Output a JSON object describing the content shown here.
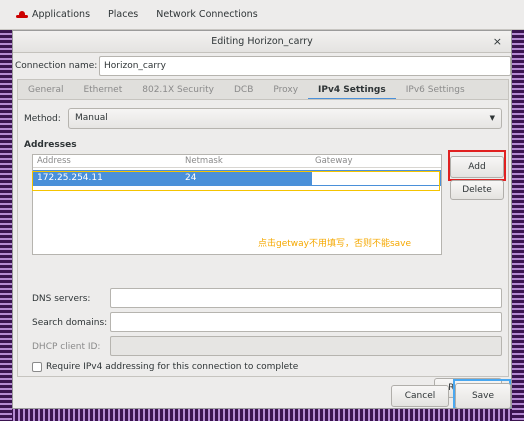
{
  "topbar": {
    "applications": "Applications",
    "places": "Places",
    "network_connections": "Network Connections"
  },
  "dialog": {
    "title": "Editing Horizon_carry",
    "close": "×"
  },
  "connection": {
    "label": "Connection name:",
    "value": "Horizon_carry"
  },
  "tabs": [
    {
      "label": "General"
    },
    {
      "label": "Ethernet"
    },
    {
      "label": "802.1X Security"
    },
    {
      "label": "DCB"
    },
    {
      "label": "Proxy"
    },
    {
      "label": "IPv4 Settings"
    },
    {
      "label": "IPv6 Settings"
    }
  ],
  "method": {
    "label": "Method:",
    "value": "Manual"
  },
  "addresses": {
    "title": "Addresses",
    "columns": {
      "address": "Address",
      "netmask": "Netmask",
      "gateway": "Gateway"
    },
    "row": {
      "address": "172.25.254.11",
      "netmask": "24",
      "gateway": ""
    },
    "add": "Add",
    "delete": "Delete"
  },
  "annotation": "点击getway不用填写，否则不能save",
  "fields": {
    "dns_label": "DNS servers:",
    "search_label": "Search domains:",
    "dhcp_label": "DHCP client ID:"
  },
  "require": "Require IPv4 addressing for this connection to complete",
  "routes": "Routes…",
  "footer": {
    "cancel": "Cancel",
    "save": "Save"
  },
  "colors": {
    "accent": "#4a90d9",
    "highlight_red": "#e02020",
    "highlight_blue": "#4aa8f0",
    "annotation": "#f5a800"
  }
}
